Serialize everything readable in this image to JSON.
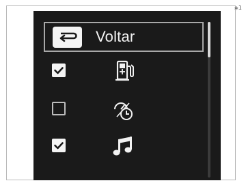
{
  "footnote": {
    "marker": "*",
    "number": "1"
  },
  "menu": {
    "back": {
      "label": "Voltar",
      "icon": "back-arrow-icon"
    },
    "items": [
      {
        "name": "fuel-economy",
        "checked": true,
        "icon": "fuel-pump-icon"
      },
      {
        "name": "trip-timer",
        "checked": false,
        "icon": "speed-timer-icon"
      },
      {
        "name": "audio",
        "checked": true,
        "icon": "music-note-icon"
      }
    ]
  },
  "colors": {
    "screen_bg": "#1a1a1a",
    "highlight_border": "#a8a8a8",
    "text": "#f2f2f2"
  }
}
